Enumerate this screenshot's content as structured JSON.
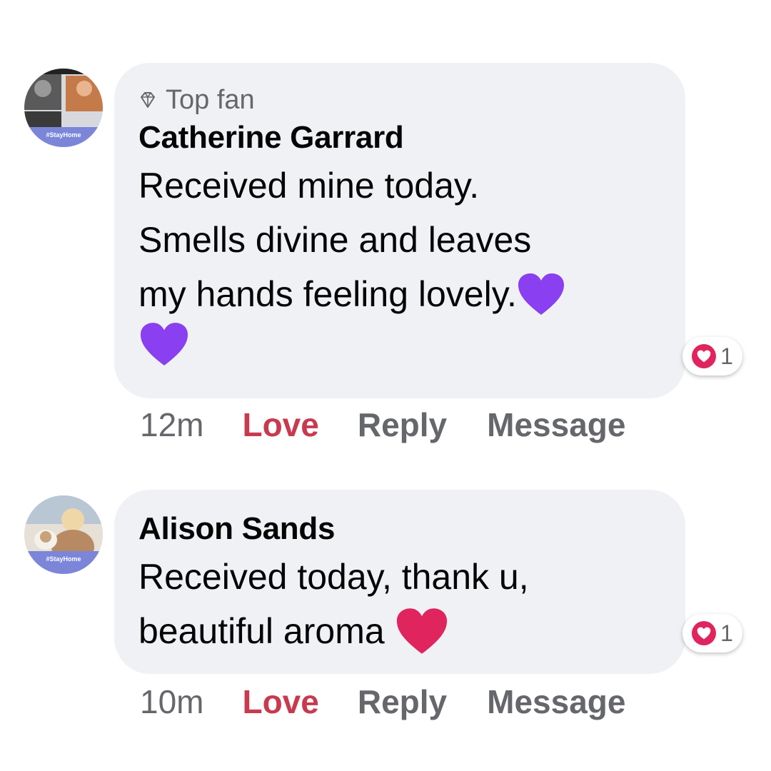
{
  "comments": [
    {
      "badge": "Top fan",
      "author": "Catherine Garrard",
      "lines": [
        "Received mine today.",
        "Smells divine and leaves",
        "my hands feeling lovely."
      ],
      "reaction_count": "1",
      "time": "12m",
      "love_label": "Love",
      "reply_label": "Reply",
      "message_label": "Message",
      "emoji": [
        "purple-heart",
        "purple-heart"
      ]
    },
    {
      "author": "Alison Sands",
      "lines": [
        "Received today, thank u,",
        "beautiful aroma"
      ],
      "reaction_count": "1",
      "time": "10m",
      "love_label": "Love",
      "reply_label": "Reply",
      "message_label": "Message",
      "emoji": [
        "red-heart"
      ]
    }
  ],
  "avatar_badge_text": "#StayHome",
  "colors": {
    "bubble": "#f0f1f5",
    "love": "#c83a4e",
    "meta": "#65676b",
    "purple_heart": "#8a3ff0",
    "red_heart": "#e0245e"
  }
}
